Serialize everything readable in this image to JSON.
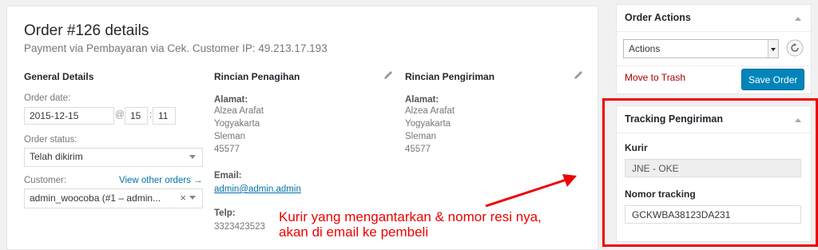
{
  "order": {
    "title": "Order #126 details",
    "subtitle": "Payment via Pembayaran via Cek. Customer IP: 49.213.17.193"
  },
  "general": {
    "title": "General Details",
    "order_date_label": "Order date:",
    "date_value": "2015-12-15",
    "at_sign": "@",
    "hour": "15",
    "colon": ":",
    "minute": "11",
    "status_label": "Order status:",
    "status_value": "Telah dikirim",
    "customer_label": "Customer:",
    "view_orders_link": "View other orders →",
    "customer_value": "admin_woocoba (#1 – admin...",
    "clear_x": "×"
  },
  "billing": {
    "title": "Rincian Penagihan",
    "address_label": "Alamat:",
    "address_lines": [
      "Alzea Arafat",
      "Yogyakarta",
      "Sleman",
      "45577"
    ],
    "email_label": "Email:",
    "email_value": "admin@admin.admin",
    "phone_label": "Telp:",
    "phone_value": "3323423523"
  },
  "shipping": {
    "title": "Rincian Pengiriman",
    "address_label": "Alamat:",
    "address_lines": [
      "Alzea Arafat",
      "Yogyakarta",
      "Sleman",
      "45577"
    ]
  },
  "order_actions": {
    "title": "Order Actions",
    "select_value": "Actions",
    "trash_link": "Move to Trash",
    "save_button": "Save Order"
  },
  "tracking": {
    "title": "Tracking Pengiriman",
    "kurir_label": "Kurir",
    "kurir_value": "JNE - OKE",
    "nomor_label": "Nomor tracking",
    "nomor_value": "GCKWBA38123DA231"
  },
  "annotation": {
    "line1": "Kurir yang mengantarkan & nomor resi nya,",
    "line2": "akan di email ke pembeli"
  },
  "colors": {
    "accent": "#0085ba",
    "link": "#0073aa",
    "trash": "#a00",
    "annotation": "#e00"
  },
  "icons": [
    "pencil-icon",
    "refresh-icon",
    "caret-up-icon",
    "dropdown-arrow-icon",
    "arrow-annotation-icon"
  ]
}
